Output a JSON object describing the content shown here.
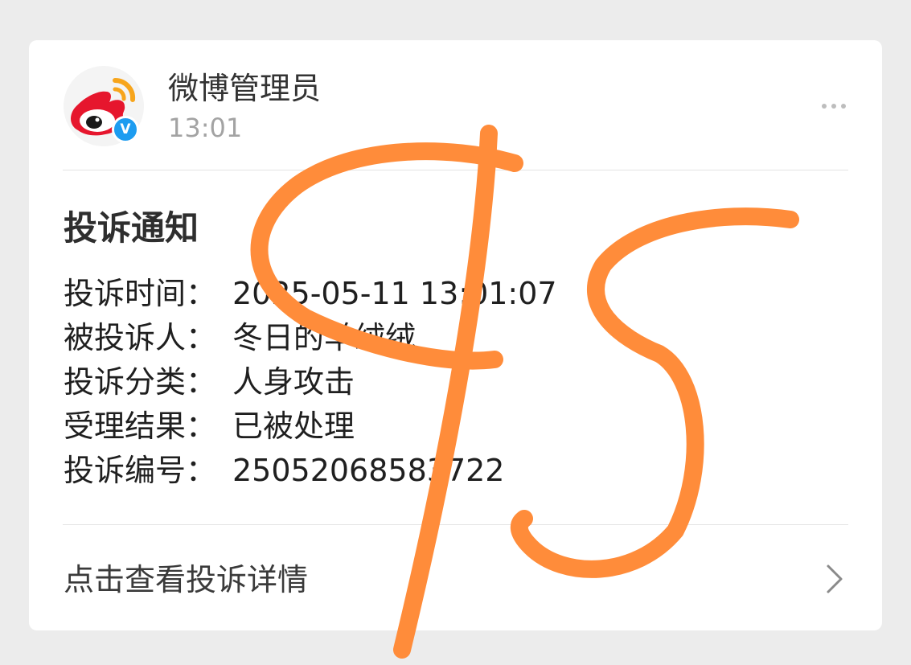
{
  "header": {
    "sender_name": "微博管理员",
    "time": "13:01",
    "verified_mark": "V",
    "avatar_icon": "weibo-logo-icon",
    "menu_icon": "more-horizontal-icon"
  },
  "notice": {
    "title": "投诉通知",
    "rows": [
      {
        "label": "投诉时间：",
        "value": "2025-05-11 13:01:07"
      },
      {
        "label": "被投诉人：",
        "value": "冬日的羊绒绒"
      },
      {
        "label": "投诉分类：",
        "value": "人身攻击"
      },
      {
        "label": "受理结果：",
        "value": "已被处理"
      },
      {
        "label": "投诉编号：",
        "value": "25052068583722"
      }
    ]
  },
  "footer": {
    "view_details_label": "点击查看投诉详情",
    "chevron_icon": "chevron-right-icon"
  },
  "colors": {
    "background": "#ececec",
    "card": "#ffffff",
    "scribble": "#ff8c3a",
    "weibo_red": "#e6162d",
    "weibo_orange": "#f7a51c",
    "verified_blue": "#1d9cf0"
  }
}
